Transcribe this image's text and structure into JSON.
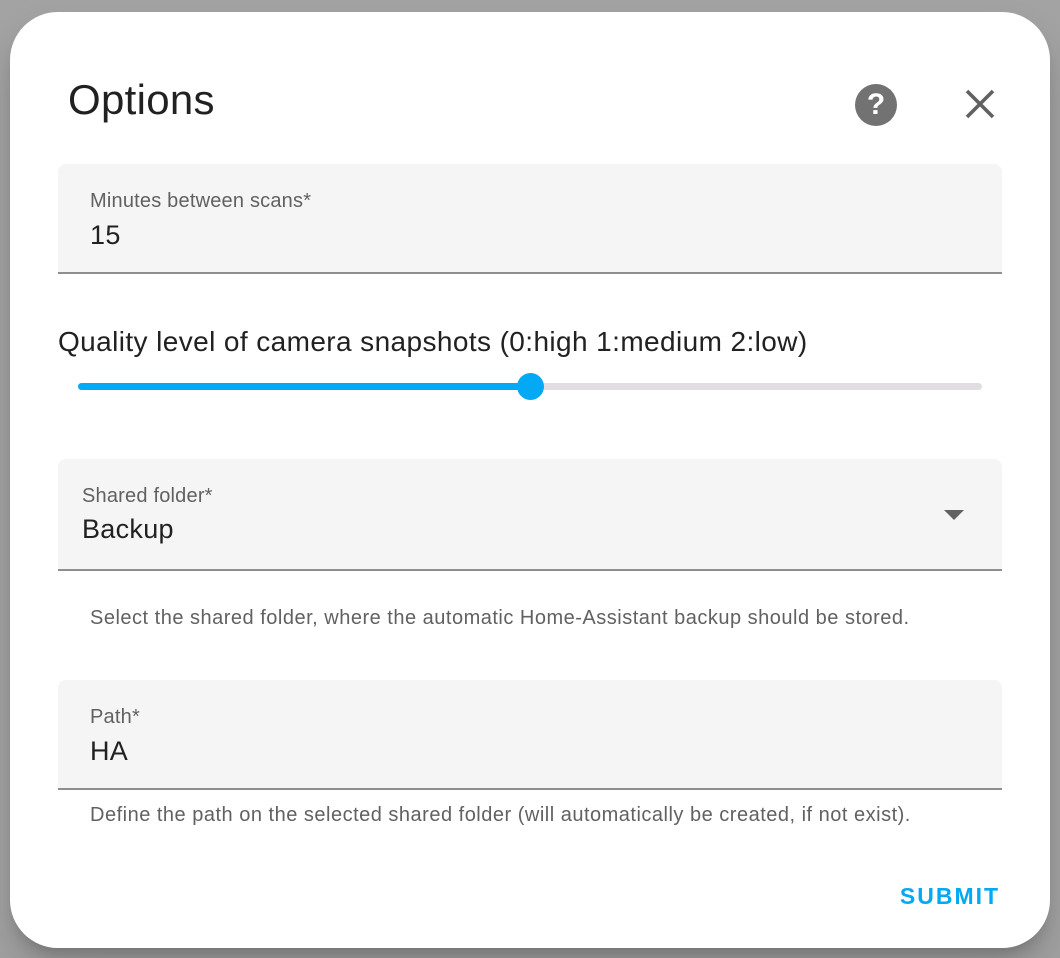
{
  "dialog": {
    "title": "Options",
    "help_icon": "help-circle-icon",
    "help_glyph": "?",
    "close_icon": "close-icon"
  },
  "fields": {
    "minutes": {
      "label": "Minutes between scans*",
      "value": "15"
    },
    "quality": {
      "label": "Quality level of camera snapshots (0:high 1:medium 2:low)",
      "min": 0,
      "max": 2,
      "value": 1
    },
    "shared_folder": {
      "label": "Shared folder*",
      "value": "Backup",
      "helper": "Select the shared folder, where the automatic Home-Assistant backup should be stored.",
      "arrow_icon": "dropdown-arrow-icon"
    },
    "path": {
      "label": "Path*",
      "value": "HA",
      "helper": "Define the path on the selected shared folder (will automatically be created, if not exist)."
    }
  },
  "actions": {
    "submit_label": "SUBMIT"
  },
  "colors": {
    "accent": "#03a9f4",
    "field_bg": "#f5f5f5",
    "help_icon": "#727272"
  }
}
